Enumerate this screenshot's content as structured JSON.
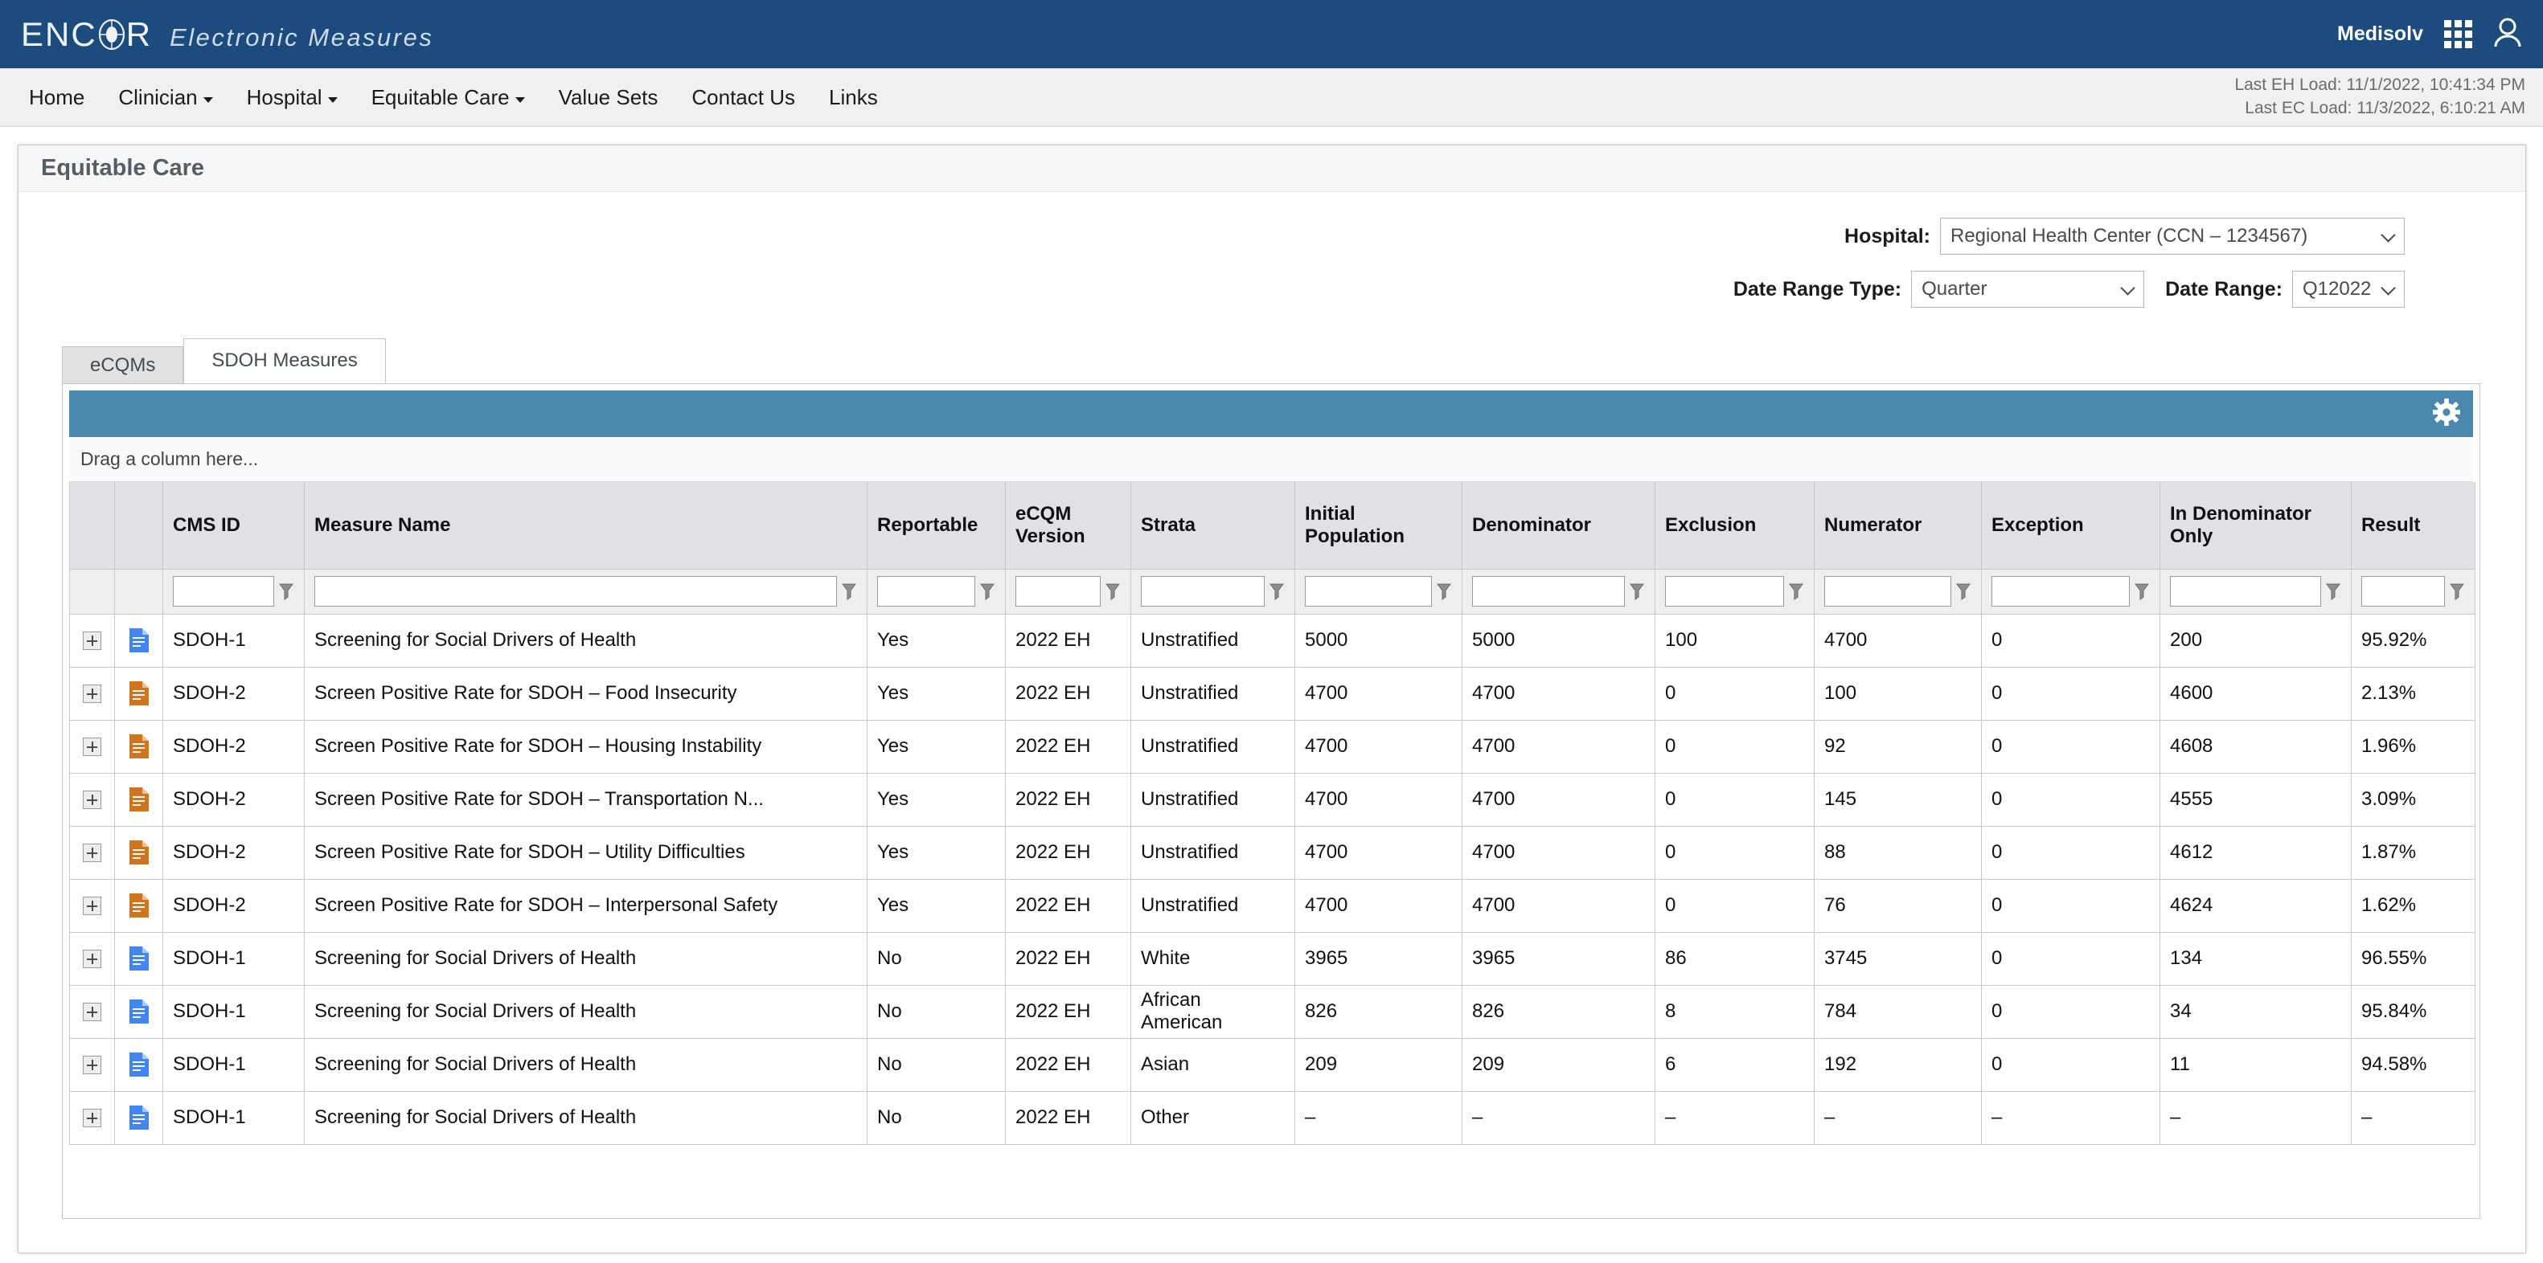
{
  "brand": {
    "logo_text": "ENCOR",
    "logo_tagline": "Electronic Measures",
    "user": "Medisolv",
    "apps_icon": "apps-grid-icon",
    "account_icon": "user-account-icon"
  },
  "nav": {
    "items": [
      {
        "label": "Home",
        "has_caret": false
      },
      {
        "label": "Clinician",
        "has_caret": true
      },
      {
        "label": "Hospital",
        "has_caret": true
      },
      {
        "label": "Equitable Care",
        "has_caret": true
      },
      {
        "label": "Value Sets",
        "has_caret": false
      },
      {
        "label": "Contact Us",
        "has_caret": false
      },
      {
        "label": "Links",
        "has_caret": false
      }
    ],
    "last_eh_load": "Last EH Load: 11/1/2022, 10:41:34 PM",
    "last_ec_load": "Last EC Load: 11/3/2022, 6:10:21 AM"
  },
  "page": {
    "title": "Equitable Care"
  },
  "filters": {
    "hospital_label": "Hospital:",
    "hospital_value": "Regional Health Center (CCN – 1234567)",
    "date_range_type_label": "Date Range Type:",
    "date_range_type_value": "Quarter",
    "date_range_label": "Date Range:",
    "date_range_value": "Q12022"
  },
  "tabs": [
    {
      "label": "eCQMs",
      "active": false
    },
    {
      "label": "SDOH Measures",
      "active": true
    }
  ],
  "grid": {
    "toolbar": {
      "settings_icon": "gear-icon",
      "background": "#4a88ad"
    },
    "group_panel_text": "Drag a column here...",
    "columns": [
      "",
      "",
      "CMS ID",
      "Measure Name",
      "Reportable",
      "eCQM Version",
      "Strata",
      "Initial Population",
      "Denominator",
      "Exclusion",
      "Numerator",
      "Exception",
      "In Denominator Only",
      "Result"
    ],
    "filter_placeholder": "",
    "rows": [
      {
        "icon_color": "#4285f4",
        "cms_id": "SDOH-1",
        "measure_name": "Screening for Social Drivers of Health",
        "reportable": "Yes",
        "version": "2022 EH",
        "strata": "Unstratified",
        "initial_population": "5000",
        "denominator": "5000",
        "exclusion": "100",
        "numerator": "4700",
        "exception": "0",
        "in_denominator_only": "200",
        "result": "95.92%"
      },
      {
        "icon_color": "#d2741d",
        "cms_id": "SDOH-2",
        "measure_name": "Screen Positive Rate for SDOH – Food Insecurity",
        "reportable": "Yes",
        "version": "2022 EH",
        "strata": "Unstratified",
        "initial_population": "4700",
        "denominator": "4700",
        "exclusion": "0",
        "numerator": "100",
        "exception": "0",
        "in_denominator_only": "4600",
        "result": "2.13%"
      },
      {
        "icon_color": "#d2741d",
        "cms_id": "SDOH-2",
        "measure_name": "Screen Positive Rate for SDOH – Housing Instability",
        "reportable": "Yes",
        "version": "2022 EH",
        "strata": "Unstratified",
        "initial_population": "4700",
        "denominator": "4700",
        "exclusion": "0",
        "numerator": "92",
        "exception": "0",
        "in_denominator_only": "4608",
        "result": "1.96%"
      },
      {
        "icon_color": "#d2741d",
        "cms_id": "SDOH-2",
        "measure_name": "Screen Positive Rate for SDOH – Transportation N...",
        "reportable": "Yes",
        "version": "2022 EH",
        "strata": "Unstratified",
        "initial_population": "4700",
        "denominator": "4700",
        "exclusion": "0",
        "numerator": "145",
        "exception": "0",
        "in_denominator_only": "4555",
        "result": "3.09%"
      },
      {
        "icon_color": "#d2741d",
        "cms_id": "SDOH-2",
        "measure_name": "Screen Positive Rate for SDOH – Utility Difficulties",
        "reportable": "Yes",
        "version": "2022 EH",
        "strata": "Unstratified",
        "initial_population": "4700",
        "denominator": "4700",
        "exclusion": "0",
        "numerator": "88",
        "exception": "0",
        "in_denominator_only": "4612",
        "result": "1.87%"
      },
      {
        "icon_color": "#d2741d",
        "cms_id": "SDOH-2",
        "measure_name": "Screen Positive Rate for SDOH – Interpersonal Safety",
        "reportable": "Yes",
        "version": "2022 EH",
        "strata": "Unstratified",
        "initial_population": "4700",
        "denominator": "4700",
        "exclusion": "0",
        "numerator": "76",
        "exception": "0",
        "in_denominator_only": "4624",
        "result": "1.62%"
      },
      {
        "icon_color": "#4285f4",
        "cms_id": "SDOH-1",
        "measure_name": "Screening for Social Drivers of Health",
        "reportable": "No",
        "version": "2022 EH",
        "strata": "White",
        "initial_population": "3965",
        "denominator": "3965",
        "exclusion": "86",
        "numerator": "3745",
        "exception": "0",
        "in_denominator_only": "134",
        "result": "96.55%"
      },
      {
        "icon_color": "#4285f4",
        "cms_id": "SDOH-1",
        "measure_name": "Screening for Social Drivers of Health",
        "reportable": "No",
        "version": "2022 EH",
        "strata": "African American",
        "initial_population": "826",
        "denominator": "826",
        "exclusion": "8",
        "numerator": "784",
        "exception": "0",
        "in_denominator_only": "34",
        "result": "95.84%"
      },
      {
        "icon_color": "#4285f4",
        "cms_id": "SDOH-1",
        "measure_name": "Screening for Social Drivers of Health",
        "reportable": "No",
        "version": "2022 EH",
        "strata": "Asian",
        "initial_population": "209",
        "denominator": "209",
        "exclusion": "6",
        "numerator": "192",
        "exception": "0",
        "in_denominator_only": "11",
        "result": "94.58%"
      },
      {
        "icon_color": "#4285f4",
        "cms_id": "SDOH-1",
        "measure_name": "Screening for Social Drivers of Health",
        "reportable": "No",
        "version": "2022 EH",
        "strata": "Other",
        "initial_population": "–",
        "denominator": "–",
        "exclusion": "–",
        "numerator": "–",
        "exception": "–",
        "in_denominator_only": "–",
        "result": "–"
      }
    ]
  },
  "colors": {
    "brand_blue": "#1c4b7d",
    "grid_toolbar_blue": "#4a88ad",
    "header_gray": "#e2e0e4"
  }
}
